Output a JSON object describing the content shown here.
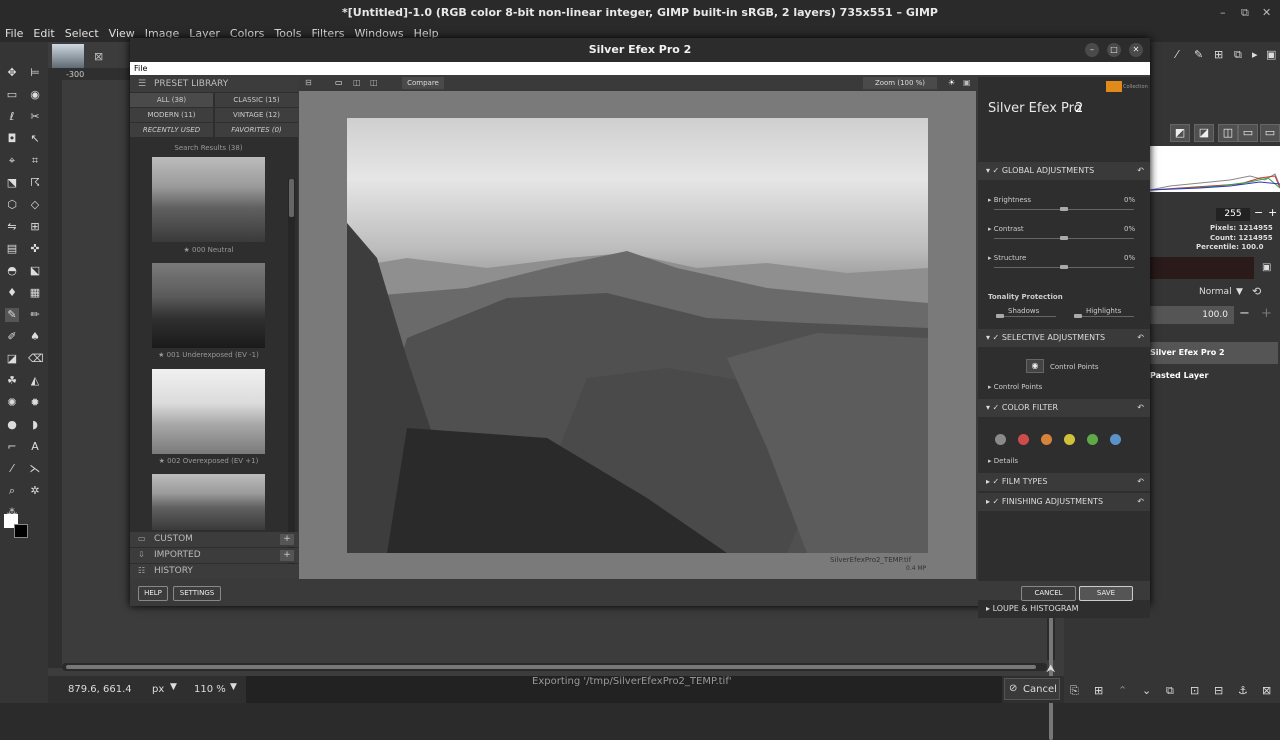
{
  "gimp": {
    "title": "*[Untitled]-1.0 (RGB color 8-bit non-linear integer, GIMP built-in sRGB, 2 layers) 735x551 – GIMP",
    "menu": [
      "File",
      "Edit",
      "Select",
      "View",
      "Image",
      "Layer",
      "Colors",
      "Tools",
      "Filters",
      "Windows",
      "Help"
    ],
    "ruler_label": "-300",
    "status": {
      "coords": "879.6, 661.4",
      "unit": "px",
      "zoom": "110 %",
      "message": "Exporting '/tmp/SilverEfexPro2_TEMP.tif'",
      "cancel": "Cancel"
    },
    "histogram": {
      "value": "255",
      "pixels": "Pixels: 1214955",
      "count": "Count: 1214955",
      "percentile": "Percentile: 100.0"
    },
    "layers": {
      "mode": "Normal",
      "opacity": "100.0",
      "items": [
        "Silver Efex Pro 2",
        "Pasted Layer"
      ]
    }
  },
  "sep": {
    "title": "Silver Efex Pro 2",
    "file_menu": "File",
    "compare": "Compare",
    "zoom": "Zoom (100 %)",
    "brand_name": "Silver Efex Pro",
    "brand_version": "2",
    "brand_logo": "Collection",
    "preset_library": "PRESET LIBRARY",
    "tabs": [
      "ALL (38)",
      "CLASSIC (15)",
      "MODERN (11)",
      "VINTAGE (12)",
      "RECENTLY USED",
      "FAVORITES (0)"
    ],
    "search_results": "Search Results (38)",
    "presets": [
      "★ 000 Neutral",
      "★ 001 Underexposed (EV -1)",
      "★ 002 Overexposed (EV +1)"
    ],
    "panels": [
      "CUSTOM",
      "IMPORTED",
      "HISTORY"
    ],
    "file_caption": "SilverEfexPro2_TEMP.tif",
    "file_mp": "0.4 MP",
    "global": "GLOBAL ADJUSTMENTS",
    "brightness": "Brightness",
    "contrast": "Contrast",
    "structure": "Structure",
    "zero": "0%",
    "tonality": "Tonality Protection",
    "shadows": "Shadows",
    "highlights": "Highlights",
    "selective": "SELECTIVE ADJUSTMENTS",
    "control_points_btn": "Control Points",
    "control_points": "Control Points",
    "color_filter": "COLOR FILTER",
    "filter_colors": [
      "#8a8a8a",
      "#d04b4b",
      "#d7843a",
      "#cfc23a",
      "#5eaa48",
      "#5b93c9"
    ],
    "details": "Details",
    "film_types": "FILM TYPES",
    "finishing": "FINISHING ADJUSTMENTS",
    "loupe": "LOUPE & HISTOGRAM",
    "help": "HELP",
    "settings": "SETTINGS",
    "cancel": "CANCEL",
    "save": "SAVE"
  }
}
